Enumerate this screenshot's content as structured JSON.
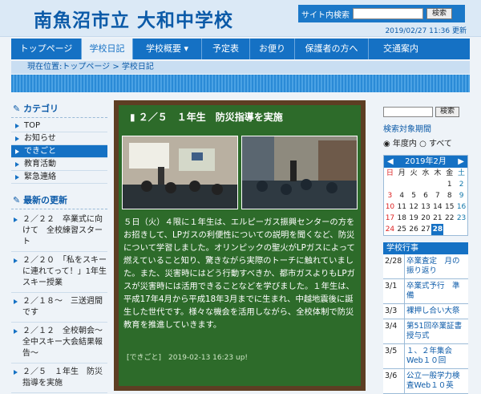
{
  "header": {
    "site_title": "南魚沼市立 大和中学校",
    "search_label": "サイト内検索",
    "search_button": "検索",
    "updated": "2019/02/27 11:36 更新"
  },
  "nav": {
    "items": [
      "トップページ",
      "学校日記",
      "学校概要 ▾",
      "予定表",
      "お便り",
      "保護者の方へ",
      "交通案内"
    ]
  },
  "breadcrumb": {
    "label": "現在位置:",
    "path": "トップページ > 学校日記"
  },
  "sidebar": {
    "category_title": "カテゴリ",
    "categories": [
      "TOP",
      "お知らせ",
      "できごと",
      "教育活動",
      "緊急連絡"
    ],
    "updates_title": "最新の更新",
    "updates": [
      "２／２２　卒業式に向けて　全校練習スタート",
      "２／２０　「私をスキーに連れてって！」1年生スキー授業",
      "２／１８～　三送週間です",
      "２／１２　全校朝会～全中スキー大会結果報告～",
      "２／５　１年生　防災指導を実施"
    ]
  },
  "post": {
    "title": "２／５　１年生　防災指導を実施",
    "body": "５日（火）４限に１年生は、エルピーガス振興センターの方をお招きして、LPガスの利便性についての説明を聞くなど、防災について学習しました。オリンピックの聖火がLPガスによって燃えていること知り、驚きながら実際のトーチに触れていました。また、災害時にはどう行動すべきか、都市ガスよりもLPガスが災害時には活用できることなどを学びました。１年生は、平成17年4月から平成18年3月までに生まれ、中越地震後に誕生した世代です。様々な機会を活用しながら、全校体制で防災教育を推進していきます。",
    "footer": "[できごと]　2019-02-13 16:23 up!"
  },
  "right": {
    "search_button": "検索",
    "scope_label": "検索対象期間",
    "scope_year": "◉ 年度内",
    "scope_all": "○ すべて",
    "calendar": {
      "month": "2019年2月",
      "weekdays": [
        "日",
        "月",
        "火",
        "水",
        "木",
        "金",
        "土"
      ],
      "days": [
        "",
        "",
        "",
        "",
        "",
        "1",
        "2",
        "3",
        "4",
        "5",
        "6",
        "7",
        "8",
        "9",
        "10",
        "11",
        "12",
        "13",
        "14",
        "15",
        "16",
        "17",
        "18",
        "19",
        "20",
        "21",
        "22",
        "23",
        "24",
        "25",
        "26",
        "27",
        "28",
        ""
      ],
      "today": "28"
    },
    "events_title": "学校行事",
    "events": [
      {
        "date": "2/28",
        "text": "卒業査定　月の振り返り"
      },
      {
        "date": "3/1",
        "text": "卒業式予行　準備"
      },
      {
        "date": "3/3",
        "text": "裸押し合い大祭"
      },
      {
        "date": "3/4",
        "text": "第51回卒業証書授与式"
      },
      {
        "date": "3/5",
        "text": "１、２年集会　Web１０回"
      },
      {
        "date": "3/6",
        "text": "公立一般学力検査Web１０英"
      }
    ]
  }
}
